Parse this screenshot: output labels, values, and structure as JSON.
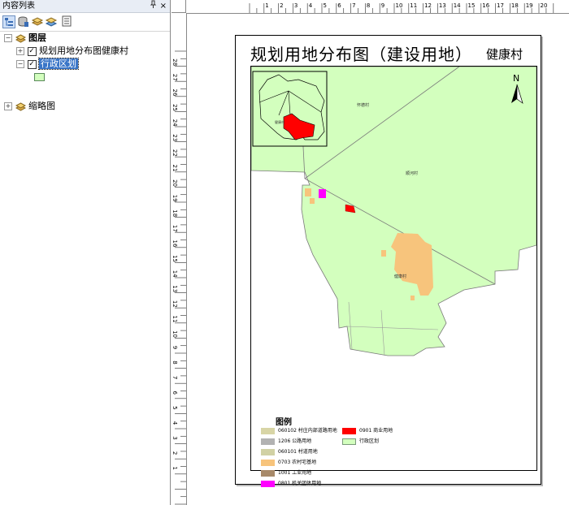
{
  "toc": {
    "title": "内容列表",
    "pin_icon": "pin-icon",
    "close_label": "×",
    "tree": {
      "layers_label": "图层",
      "layer1_label": "规划用地分布图健康村",
      "layer2_label": "行政区划",
      "overview_label": "缩略图",
      "expand_plus": "+",
      "expand_minus": "−",
      "check_mark": "✓"
    }
  },
  "map": {
    "title": "规划用地分布图（建设用地）",
    "village": "健康村",
    "north_label": "N",
    "labels": {
      "upper_village": "怀德村",
      "right_village": "顺河村",
      "main_village": "健康村",
      "inset_label": "健康村"
    }
  },
  "legend": {
    "title": "图例",
    "items": [
      {
        "label": "060102 村庄内部道路用地",
        "color": "#d8d5a6"
      },
      {
        "label": "1206 公路用地",
        "color": "#b2b2b2"
      },
      {
        "label": "060101 村道用地",
        "color": "#d1d1a4"
      },
      {
        "label": "0703 农村宅基地",
        "color": "#f7c47c"
      },
      {
        "label": "1001 工业用地",
        "color": "#a88a6a"
      },
      {
        "label": "0801 机关团体用地",
        "color": "#ff00ff"
      },
      {
        "label": "0901 商业用地",
        "color": "#ff0000"
      },
      {
        "label": "行政区划",
        "color": "#d3ffbe"
      }
    ]
  },
  "rulers": {
    "horizontal": [
      "1",
      "2",
      "3",
      "4",
      "5",
      "6",
      "7",
      "8",
      "9",
      "10",
      "11",
      "12",
      "13",
      "14",
      "15",
      "16",
      "17",
      "18",
      "19",
      "20"
    ],
    "vertical": [
      "28",
      "27",
      "26",
      "25",
      "24",
      "23",
      "22",
      "21",
      "20",
      "19",
      "18",
      "17",
      "16",
      "15",
      "14",
      "13",
      "12",
      "11",
      "10",
      "9",
      "8",
      "7",
      "6",
      "5",
      "4",
      "3",
      "2",
      "1"
    ]
  }
}
